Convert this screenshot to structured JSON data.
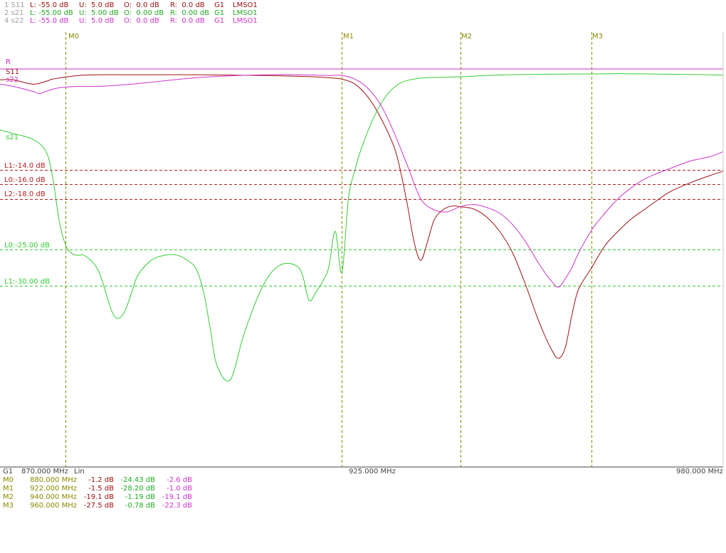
{
  "colors": {
    "s11": "#a01010",
    "s21": "#33cc33",
    "s22": "#cc33cc",
    "marker": "#8a8a00",
    "limit_s11": "#b02020",
    "limit_s21": "#33cc33",
    "axis": "#444444"
  },
  "header": [
    {
      "trace": "1 S11",
      "color": "#a01010",
      "L": "L: -55.0 dB",
      "U": "U:  5.0 dB",
      "O": "O:  0.0 dB",
      "R": "R:  0.0 dB",
      "G": "G1",
      "src": "LMSO1"
    },
    {
      "trace": "2 s21",
      "color": "#33cc33",
      "L": "L: -55.00 dB",
      "U": "U:  5.00 dB",
      "O": "O:  0.00 dB",
      "R": "R:  0.00 dB",
      "G": "G1",
      "src": "LMSO1"
    },
    {
      "trace": "4 s22",
      "color": "#cc33cc",
      "L": "L: -55.0 dB",
      "U": "U:  5.0 dB",
      "O": "O:  0.0 dB",
      "R": "R:  0.0 dB",
      "G": "G1",
      "src": "LMSO1"
    }
  ],
  "trace_labels": {
    "ref": "R",
    "s11": "S11",
    "s22": "s22",
    "s21": "s21"
  },
  "limit_lines": [
    {
      "name": "L1:-14.0 dB",
      "value": -14,
      "trace": "s11"
    },
    {
      "name": "L0:-16.0 dB",
      "value": -16,
      "trace": "s11"
    },
    {
      "name": "L2:-18.0 dB",
      "value": -18,
      "trace": "s11"
    },
    {
      "name": "L0:-25.00 dB",
      "value": -25,
      "trace": "s21"
    },
    {
      "name": "L1:-30.00 dB",
      "value": -30,
      "trace": "s21"
    }
  ],
  "markers": [
    {
      "name": "M0",
      "freq": 880,
      "freq_label": "880.000 MHz",
      "s11": "-1.2 dB",
      "s21": "-24.43 dB",
      "s22": "-2.6 dB"
    },
    {
      "name": "M1",
      "freq": 922,
      "freq_label": "922.000 MHz",
      "s11": "-1.5 dB",
      "s21": "-28.20 dB",
      "s22": "-1.0 dB"
    },
    {
      "name": "M2",
      "freq": 940,
      "freq_label": "940.000 MHz",
      "s11": "-19.1 dB",
      "s21": "-1.19 dB",
      "s22": "-19.1 dB"
    },
    {
      "name": "M3",
      "freq": 960,
      "freq_label": "960.000 MHz",
      "s11": "-27.5 dB",
      "s21": "-0.78 dB",
      "s22": "-22.3 dB"
    }
  ],
  "footer": {
    "group": "G1",
    "start": "870.000 MHz",
    "scale": "Lin",
    "center": "925.000 MHz",
    "stop": "980.000 MHz"
  },
  "chart_data": {
    "type": "line",
    "x_range": [
      870,
      980
    ],
    "y_range": [
      -55,
      5
    ],
    "series": [
      {
        "name": "S11",
        "x": [
          870,
          872,
          875,
          877,
          878,
          880,
          882,
          885,
          890,
          900,
          910,
          915,
          918,
          920,
          922,
          924,
          926,
          928,
          930,
          931,
          932,
          933,
          934,
          935,
          936,
          937,
          938,
          939,
          940,
          942,
          944,
          946,
          948,
          950,
          952,
          954,
          955,
          956,
          957,
          958,
          960,
          962,
          964,
          966,
          968,
          970,
          972,
          975,
          978,
          980
        ],
        "y": [
          -1.6,
          -1.6,
          -2.2,
          -1.8,
          -1.5,
          -1.2,
          -1.0,
          -0.9,
          -0.9,
          -0.9,
          -1.0,
          -1.1,
          -1.2,
          -1.3,
          -1.5,
          -2.2,
          -4.0,
          -7.0,
          -11.0,
          -14.5,
          -19.0,
          -24.0,
          -26.5,
          -24.0,
          -21.0,
          -19.8,
          -19.2,
          -19.0,
          -19.1,
          -19.4,
          -20.5,
          -22.5,
          -25.5,
          -30.0,
          -35.0,
          -39.0,
          -40.0,
          -38.5,
          -34.0,
          -30.5,
          -27.5,
          -24.5,
          -22.5,
          -20.8,
          -19.5,
          -18.2,
          -17.0,
          -15.8,
          -14.8,
          -14.2
        ]
      },
      {
        "name": "s21",
        "x": [
          870,
          872,
          875,
          877,
          878,
          879,
          880,
          881,
          882,
          883,
          885,
          887,
          888,
          889,
          890,
          891,
          893,
          895,
          897,
          899,
          900,
          901,
          902,
          903,
          905,
          907,
          909,
          911,
          913,
          915,
          916,
          917,
          918,
          919,
          920,
          921,
          922,
          923,
          924,
          925,
          927,
          929,
          931,
          933,
          935,
          937,
          939,
          940,
          942,
          945,
          950,
          955,
          960,
          965,
          970,
          975,
          980
        ],
        "y": [
          -8.5,
          -9.0,
          -9.8,
          -11.5,
          -15.0,
          -21.0,
          -24.43,
          -25.6,
          -25.8,
          -25.9,
          -28.0,
          -33.5,
          -34.5,
          -33.5,
          -31.0,
          -28.5,
          -26.5,
          -25.8,
          -25.8,
          -26.8,
          -28.0,
          -31.0,
          -36.0,
          -41.0,
          -43.0,
          -37.0,
          -32.0,
          -28.5,
          -27.0,
          -27.2,
          -28.5,
          -32.0,
          -31.0,
          -29.5,
          -27.5,
          -22.5,
          -28.2,
          -18.0,
          -14.0,
          -11.0,
          -6.5,
          -3.5,
          -2.0,
          -1.5,
          -1.3,
          -1.25,
          -1.2,
          -1.19,
          -1.1,
          -0.95,
          -0.85,
          -0.8,
          -0.78,
          -0.75,
          -0.8,
          -0.85,
          -0.95
        ]
      },
      {
        "name": "s22",
        "x": [
          870,
          872,
          875,
          876,
          877,
          878,
          879,
          880,
          882,
          885,
          890,
          900,
          910,
          915,
          918,
          920,
          922,
          924,
          926,
          928,
          930,
          932,
          934,
          936,
          938,
          940,
          942,
          944,
          946,
          948,
          950,
          952,
          954,
          955,
          956,
          957,
          958,
          960,
          962,
          964,
          966,
          968,
          970,
          972,
          975,
          978,
          980
        ],
        "y": [
          -2.2,
          -2.5,
          -3.2,
          -3.5,
          -3.2,
          -2.9,
          -2.7,
          -2.6,
          -2.5,
          -2.5,
          -2.2,
          -1.3,
          -0.9,
          -0.9,
          -0.95,
          -1.0,
          -1.0,
          -1.5,
          -2.8,
          -5.2,
          -9.0,
          -13.5,
          -18.0,
          -19.5,
          -19.8,
          -19.1,
          -18.8,
          -19.2,
          -20.0,
          -21.6,
          -24.0,
          -27.0,
          -29.5,
          -30.2,
          -29.0,
          -27.5,
          -25.5,
          -22.3,
          -20.0,
          -18.0,
          -16.5,
          -15.3,
          -14.5,
          -13.8,
          -12.8,
          -12.2,
          -11.5
        ]
      }
    ],
    "ref_line_db": 0
  }
}
